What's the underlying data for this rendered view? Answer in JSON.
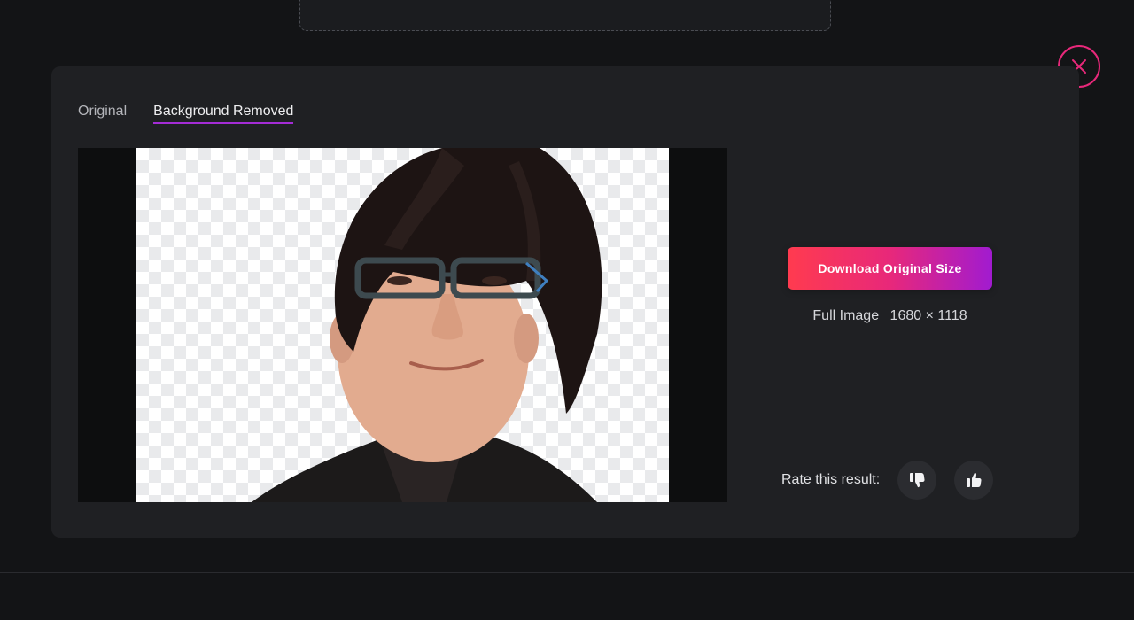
{
  "tabs": [
    {
      "label": "Original",
      "active": false
    },
    {
      "label": "Background Removed",
      "active": true
    }
  ],
  "download": {
    "label": "Download Original Size"
  },
  "image_info": {
    "label": "Full Image",
    "dimensions": "1680 × 1118"
  },
  "rating": {
    "label": "Rate this result:"
  },
  "icons": {
    "close": "close-icon",
    "thumbs_down": "thumbs-down-icon",
    "thumbs_up": "thumbs-up-icon"
  },
  "colors": {
    "accent_pink": "#e8287a",
    "accent_purple": "#a42cd6",
    "gradient_start": "#ff3b4f",
    "gradient_end": "#a11bd0",
    "panel_bg": "#1f2023",
    "page_bg": "#131416"
  }
}
